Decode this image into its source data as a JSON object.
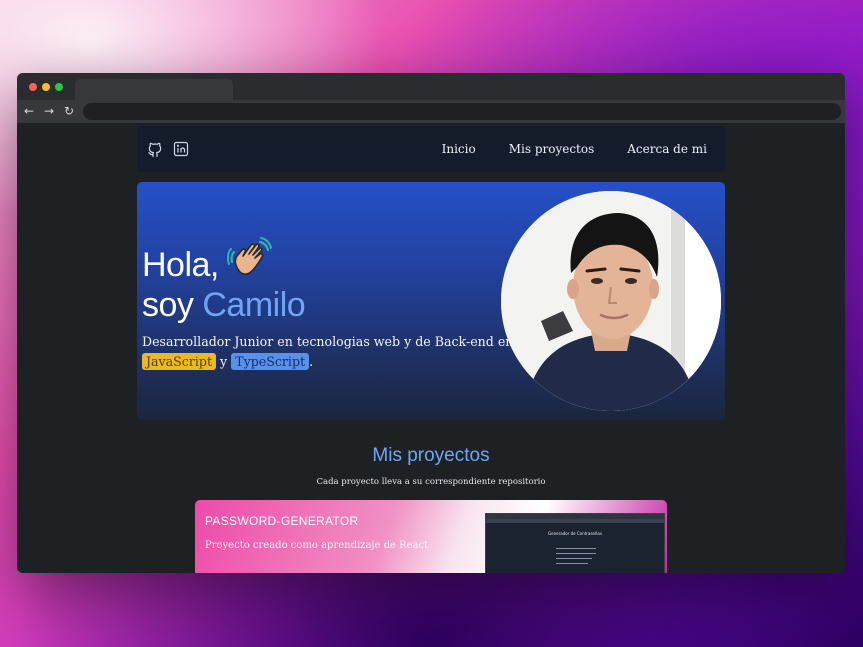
{
  "site_nav": {
    "links": [
      "Inicio",
      "Mis proyectos",
      "Acerca de mi"
    ]
  },
  "hero": {
    "greeting": "Hola,",
    "intro": "soy",
    "name": "Camilo",
    "desc_main": "Desarrollador Junior en tecnologias web y de Back-end en",
    "tag_js": "JavaScript",
    "conj": "y",
    "tag_ts": "TypeScript",
    "period": "."
  },
  "projects": {
    "title": "Mis proyectos",
    "subtitle": "Cada proyecto lleva a su correspondiente repositorio",
    "cards": [
      {
        "title": "PASSWORD-GENERATOR",
        "description": "Proyecto creado como aprendizaje de React",
        "preview_heading": "Generador de Contraseñas"
      }
    ]
  },
  "colors": {
    "accent": "#6fa6f4",
    "nav_bg": "#141c2c",
    "js_tag": "#e9bb22",
    "ts_tag": "#5a90e8"
  },
  "icons": [
    "github-icon",
    "linkedin-icon",
    "waving-hand-icon",
    "back-arrow-icon",
    "forward-arrow-icon",
    "reload-icon"
  ]
}
